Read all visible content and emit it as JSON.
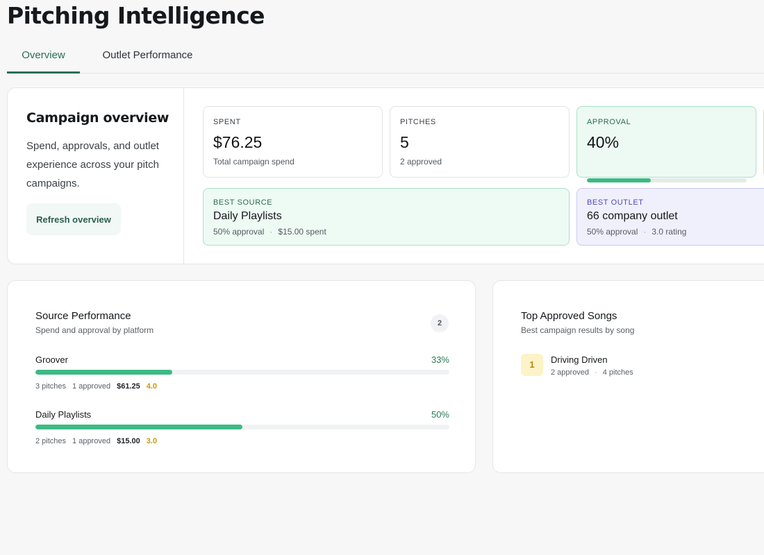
{
  "page": {
    "title": "Pitching Intelligence"
  },
  "tabs": [
    {
      "label": "Overview",
      "active": true
    },
    {
      "label": "Outlet Performance",
      "active": false
    }
  ],
  "overview": {
    "heading": "Campaign overview",
    "description": "Spend, approvals, and outlet experience across your pitch campaigns.",
    "refresh_label": "Refresh overview",
    "stats": {
      "spent": {
        "label": "SPENT",
        "value": "$76.25",
        "sub": "Total campaign spend"
      },
      "pitches": {
        "label": "PITCHES",
        "value": "5",
        "sub": "2 approved"
      },
      "approval": {
        "label": "APPROVAL",
        "value": "40%",
        "progress": 0.4
      }
    },
    "best_source": {
      "label": "BEST SOURCE",
      "name": "Daily Playlists",
      "approval": "50% approval",
      "spent": "$15.00 spent"
    },
    "best_outlet": {
      "label": "BEST OUTLET",
      "name": "66 company outlet",
      "approval": "50% approval",
      "rating": "3.0 rating"
    }
  },
  "source_performance": {
    "title": "Source Performance",
    "subtitle": "Spend and approval by platform",
    "count": "2",
    "sources": [
      {
        "name": "Groover",
        "approval_pct": "33%",
        "progress": 0.33,
        "pitches": "3 pitches",
        "approved": "1 approved",
        "spend": "$61.25",
        "rating": "4.0"
      },
      {
        "name": "Daily Playlists",
        "approval_pct": "50%",
        "progress": 0.5,
        "pitches": "2 pitches",
        "approved": "1 approved",
        "spend": "$15.00",
        "rating": "3.0"
      }
    ]
  },
  "top_songs": {
    "title": "Top Approved Songs",
    "subtitle": "Best campaign results by song",
    "songs": [
      {
        "rank": "1",
        "name": "Driving Driven",
        "approved": "2 approved",
        "pitches": "4 pitches"
      }
    ]
  },
  "colors": {
    "accent": "#2b6e58",
    "progress_fill": "#3dba84",
    "rating": "#c99a08",
    "outlet_label": "#4b48b5"
  }
}
